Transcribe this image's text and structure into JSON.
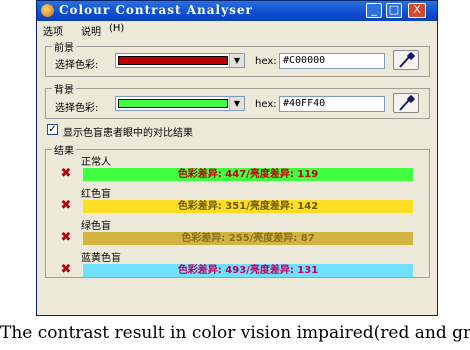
{
  "window": {
    "title": "Colour Contrast Analyser",
    "buttons": {
      "minimize": "_",
      "maximize": "□",
      "close": "X"
    }
  },
  "menu": [
    "选项",
    "说明",
    "(H)"
  ],
  "foreground": {
    "legend": "前景",
    "select_label": "选择色彩:",
    "color": "#C00000",
    "hex_label": "hex:",
    "hex_value": "#C00000"
  },
  "background": {
    "legend": "背景",
    "select_label": "选择色彩:",
    "color": "#40FF40",
    "hex_label": "hex:",
    "hex_value": "#40FF40"
  },
  "option": {
    "checked": true,
    "label": "显示色盲患者眼中的对比结果"
  },
  "results": {
    "legend": "结果",
    "items": [
      {
        "label": "正常人",
        "text": "色彩差异: 447/亮度差异: 119",
        "bg": "#40ff40",
        "fg": "#c00000"
      },
      {
        "label": "红色盲",
        "text": "色彩差异: 351/亮度差异: 142",
        "bg": "#ffdd22",
        "fg": "#6b5a00"
      },
      {
        "label": "绿色盲",
        "text": "色彩差异: 255/亮度差异: 87",
        "bg": "#d4b440",
        "fg": "#8a7020"
      },
      {
        "label": "蓝黄色盲",
        "text": "色彩差异: 493/亮度差异: 131",
        "bg": "#70e0ff",
        "fg": "#c00060"
      }
    ],
    "fail_icon": "✖"
  },
  "caption": "The contrast result in color vision impaired(red and gr"
}
